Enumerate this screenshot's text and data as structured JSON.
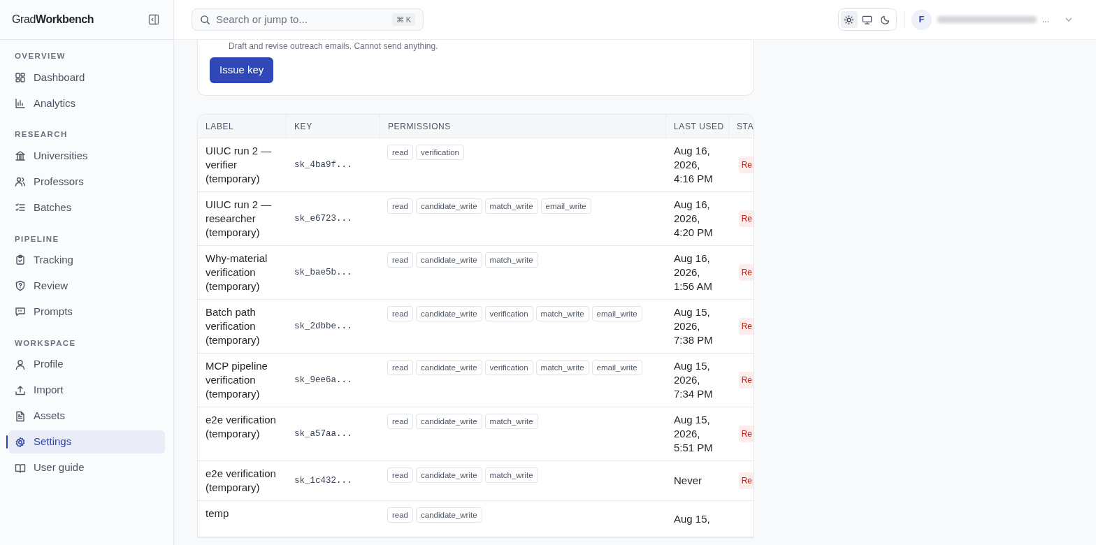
{
  "brand": {
    "prefix": "Grad",
    "name": "Workbench"
  },
  "search": {
    "placeholder": "Search or jump to...",
    "shortcut": "⌘ K"
  },
  "theme_toggle": [
    {
      "kind": "light",
      "selected": true
    },
    {
      "kind": "system",
      "selected": false
    },
    {
      "kind": "dark",
      "selected": false
    }
  ],
  "account": {
    "initial": "F",
    "name_tail": "..."
  },
  "sidebar": {
    "sections": [
      {
        "title": "OVERVIEW",
        "items": [
          {
            "label": "Dashboard",
            "kind": "grid",
            "selected": false
          },
          {
            "label": "Analytics",
            "kind": "chart",
            "selected": false
          }
        ]
      },
      {
        "title": "RESEARCH",
        "items": [
          {
            "label": "Universities",
            "kind": "building",
            "selected": false
          },
          {
            "label": "Professors",
            "kind": "users",
            "selected": false
          },
          {
            "label": "Batches",
            "kind": "list",
            "selected": false
          }
        ]
      },
      {
        "title": "PIPELINE",
        "items": [
          {
            "label": "Tracking",
            "kind": "clipboard",
            "selected": false
          },
          {
            "label": "Review",
            "kind": "shield",
            "selected": false
          },
          {
            "label": "Prompts",
            "kind": "message",
            "selected": false
          }
        ]
      },
      {
        "title": "WORKSPACE",
        "items": [
          {
            "label": "Profile",
            "kind": "user",
            "selected": false
          },
          {
            "label": "Import",
            "kind": "upload",
            "selected": false
          },
          {
            "label": "Assets",
            "kind": "file",
            "selected": false
          },
          {
            "label": "Settings",
            "kind": "gear",
            "selected": true
          },
          {
            "label": "User guide",
            "kind": "book",
            "selected": false
          }
        ]
      }
    ]
  },
  "issue_card": {
    "note": "Draft and revise outreach emails. Cannot send anything.",
    "button": "Issue key"
  },
  "table": {
    "columns": [
      "LABEL",
      "KEY",
      "PERMISSIONS",
      "LAST USED",
      "STA"
    ],
    "rows": [
      {
        "label": "UIUC run 2 — verifier (temporary)",
        "key": "sk_4ba9f...",
        "permissions": [
          "read",
          "verification"
        ],
        "last_used": "Aug 16, 2026, 4:16 PM",
        "status": "Re"
      },
      {
        "label": "UIUC run 2 — researcher (temporary)",
        "key": "sk_e6723...",
        "permissions": [
          "read",
          "candidate_write",
          "match_write",
          "email_write"
        ],
        "last_used": "Aug 16, 2026, 4:20 PM",
        "status": "Re"
      },
      {
        "label": "Why-material verification (temporary)",
        "key": "sk_bae5b...",
        "permissions": [
          "read",
          "candidate_write",
          "match_write"
        ],
        "last_used": "Aug 16, 2026, 1:56 AM",
        "status": "Re"
      },
      {
        "label": "Batch path verification (temporary)",
        "key": "sk_2dbbe...",
        "permissions": [
          "read",
          "candidate_write",
          "verification",
          "match_write",
          "email_write"
        ],
        "last_used": "Aug 15, 2026, 7:38 PM",
        "status": "Re"
      },
      {
        "label": "MCP pipeline verification (temporary)",
        "key": "sk_9ee6a...",
        "permissions": [
          "read",
          "candidate_write",
          "verification",
          "match_write",
          "email_write"
        ],
        "last_used": "Aug 15, 2026, 7:34 PM",
        "status": "Re"
      },
      {
        "label": "e2e verification (temporary)",
        "key": "sk_a57aa...",
        "permissions": [
          "read",
          "candidate_write",
          "match_write"
        ],
        "last_used": "Aug 15, 2026, 5:51 PM",
        "status": "Re"
      },
      {
        "label": "e2e verification (temporary)",
        "key": "sk_1c432...",
        "permissions": [
          "read",
          "candidate_write",
          "match_write"
        ],
        "last_used": "Never",
        "status": "Re"
      },
      {
        "label": "temp",
        "key": "",
        "permissions": [
          "read",
          "candidate_write"
        ],
        "last_used": "Aug 15,",
        "status": ""
      }
    ]
  }
}
